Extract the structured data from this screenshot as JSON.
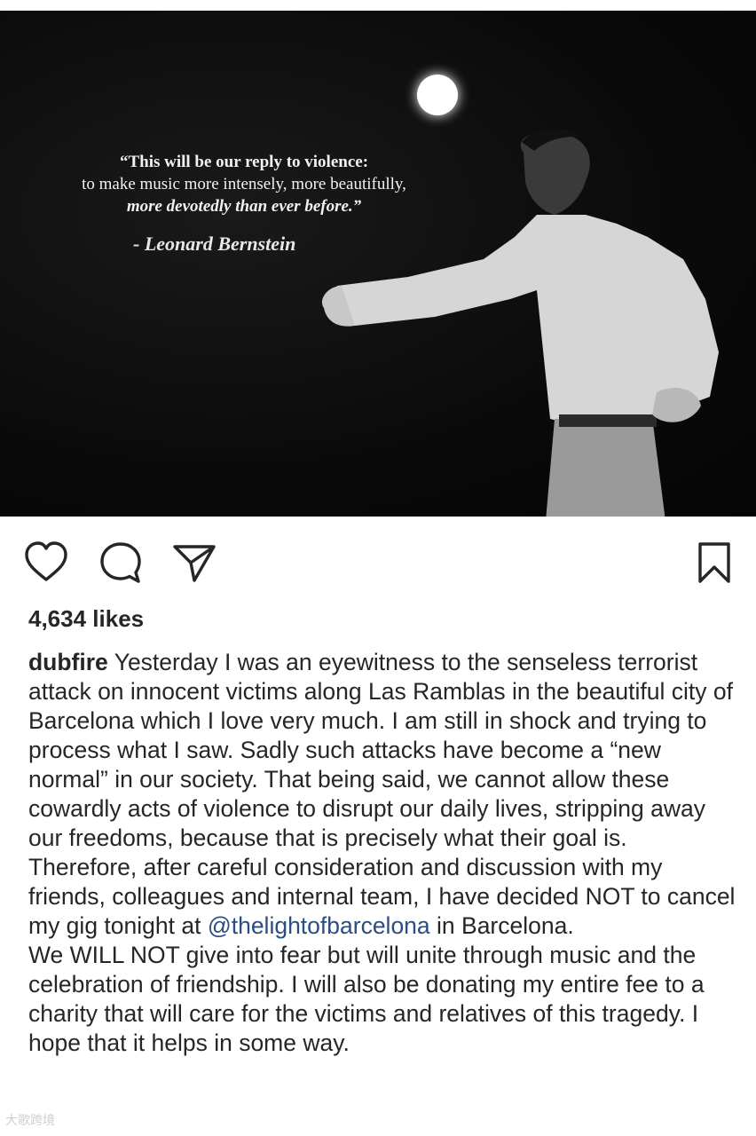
{
  "photo": {
    "quote_line1": "“This will be our reply to violence:",
    "quote_line2": "to make music more intensely, more beautifully,",
    "quote_line3": "more devotedly than ever before.”",
    "author": "- Leonard Bernstein"
  },
  "actions": {
    "like_icon": "heart-icon",
    "comment_icon": "comment-icon",
    "share_icon": "send-icon",
    "save_icon": "bookmark-icon"
  },
  "likes": "4,634 likes",
  "caption": {
    "username": "dubfire",
    "text_before_mention": " Yesterday I was an eyewitness to the senseless terrorist attack on innocent victims along Las Ramblas in the beautiful city of Barcelona which I love very much. I am still in shock and trying to process what I saw. Sadly such attacks have become a “new normal” in our society. That being said, we cannot allow these cowardly acts of violence to disrupt our daily lives, stripping away our freedoms, because that is precisely what their goal is. Therefore, after careful consideration and discussion with my friends, colleagues and internal team, I have decided NOT to cancel my gig tonight at ",
    "mention": "@thelightofbarcelona",
    "text_after_mention": " in Barcelona.",
    "paragraph2": "We WILL NOT give into fear but will unite through music and the celebration of friendship. I will also be donating my entire fee to a charity that will care for the victims and relatives of this tragedy. I hope that it helps in some way."
  },
  "watermark": "大歌跨境",
  "colors": {
    "text": "#262626",
    "mention": "#2b4d7f",
    "photo_bg": "#0a0a0a"
  }
}
